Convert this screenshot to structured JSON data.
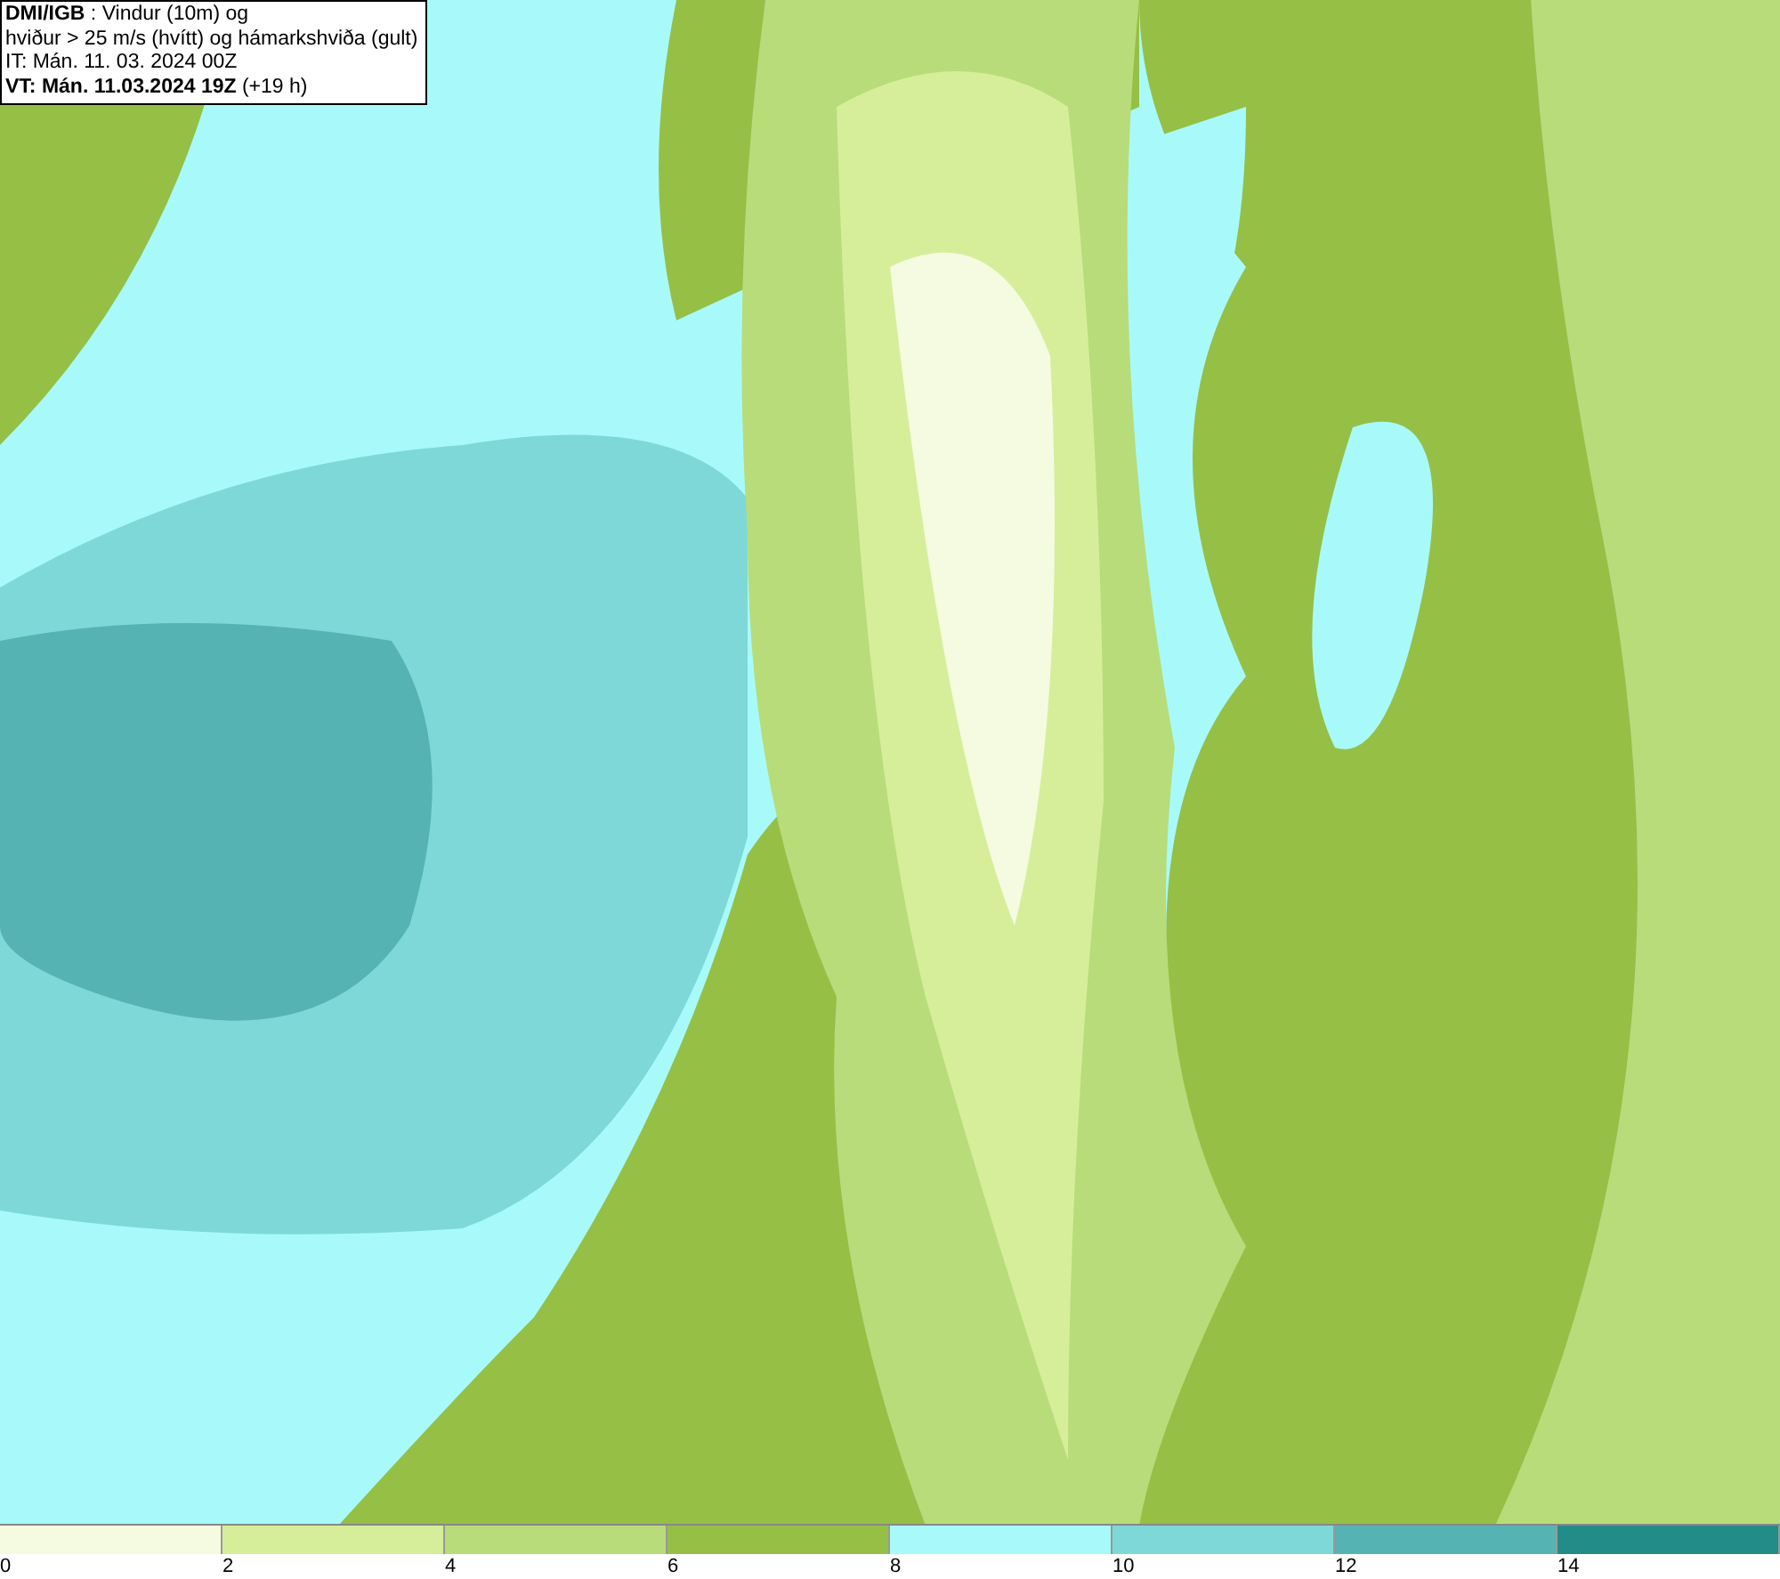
{
  "info_box": {
    "lines": [
      "**DMI/IGB** : Vindur (10m) og",
      "hviður > 25 m/s (hvítt) og hámarkshviða (gult)",
      "IT: Mán. 11. 03. 2024 00Z",
      "**VT: Mán. 11.03.2024 19Z** (+19 h)"
    ]
  },
  "legend": {
    "bins": [
      {
        "color": "#f4fbe0",
        "label": "0"
      },
      {
        "color": "#d6ee9a",
        "label": "2"
      },
      {
        "color": "#b8dc7a",
        "label": "4"
      },
      {
        "color": "#96bf46",
        "label": "6"
      },
      {
        "color": "#a8fafa",
        "label": "8"
      },
      {
        "color": "#7fd8d8",
        "label": "10"
      },
      {
        "color": "#55b3b3",
        "label": "12"
      },
      {
        "color": "#228c88",
        "label": "14"
      }
    ]
  }
}
